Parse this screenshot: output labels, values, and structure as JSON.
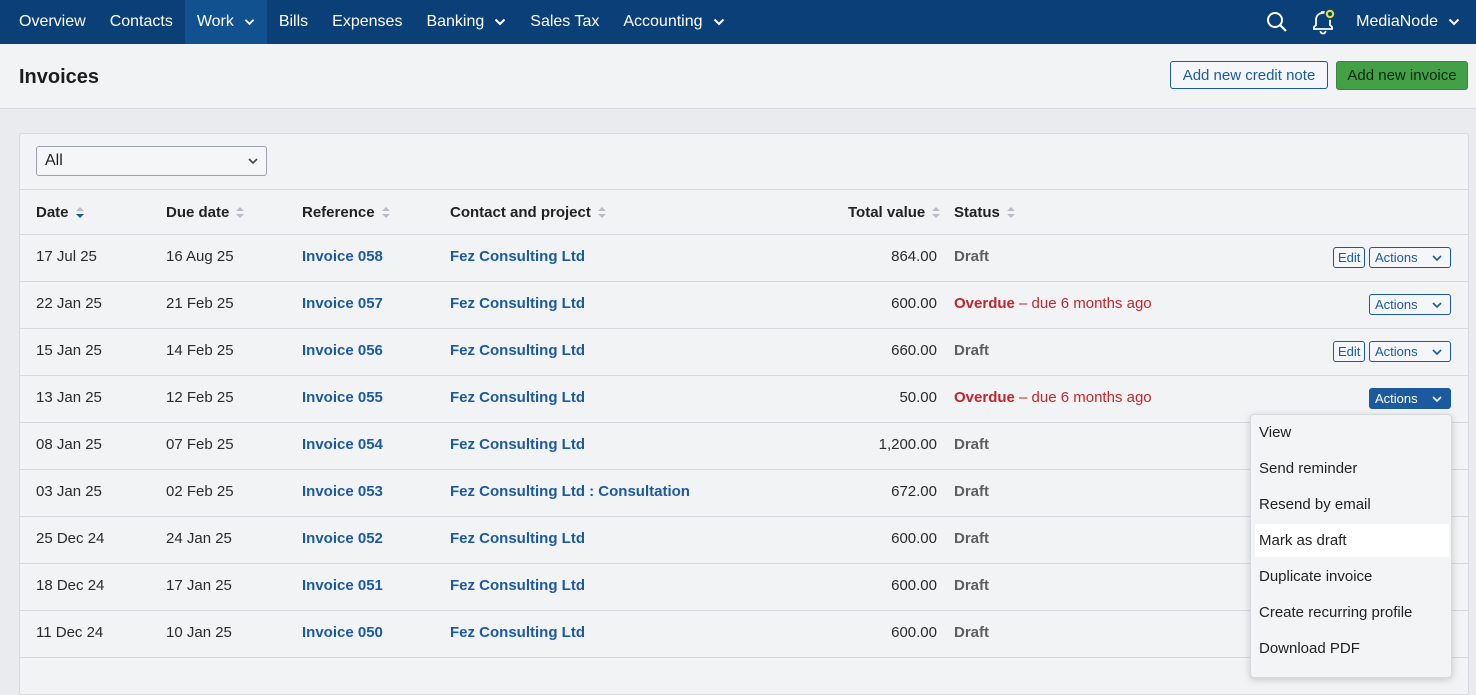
{
  "nav": {
    "items": [
      {
        "label": "Overview",
        "dropdown": false
      },
      {
        "label": "Contacts",
        "dropdown": false
      },
      {
        "label": "Work",
        "dropdown": true,
        "active": true
      },
      {
        "label": "Bills",
        "dropdown": false
      },
      {
        "label": "Expenses",
        "dropdown": false
      },
      {
        "label": "Banking",
        "dropdown": true
      },
      {
        "label": "Sales Tax",
        "dropdown": false
      },
      {
        "label": "Accounting",
        "dropdown": true
      }
    ],
    "user": "MediaNode",
    "icons": {
      "search": "search-icon",
      "notifications": "bell-icon"
    },
    "colors": {
      "bar": "#0b3f78",
      "active": "#12518f"
    }
  },
  "header": {
    "title": "Invoices",
    "credit_note_button": "Add new credit note",
    "new_invoice_button": "Add new invoice"
  },
  "filter": {
    "value": "All"
  },
  "table": {
    "columns": [
      "Date",
      "Due date",
      "Reference",
      "Contact and project",
      "Total value",
      "Status"
    ],
    "rows": [
      {
        "date": "17 Jul 25",
        "due": "16 Aug 25",
        "ref": "Invoice 058",
        "contact": "Fez Consulting Ltd",
        "total": "864.00",
        "status": "Draft",
        "status_note": "",
        "edit": "Edit",
        "actions": "Actions"
      },
      {
        "date": "22 Jan 25",
        "due": "21 Feb 25",
        "ref": "Invoice 057",
        "contact": "Fez Consulting Ltd",
        "total": "600.00",
        "status": "Overdue",
        "status_note": " – due 6 months ago",
        "edit": "",
        "actions": "Actions"
      },
      {
        "date": "15 Jan 25",
        "due": "14 Feb 25",
        "ref": "Invoice 056",
        "contact": "Fez Consulting Ltd",
        "total": "660.00",
        "status": "Draft",
        "status_note": "",
        "edit": "Edit",
        "actions": "Actions"
      },
      {
        "date": "13 Jan 25",
        "due": "12 Feb 25",
        "ref": "Invoice 055",
        "contact": "Fez Consulting Ltd",
        "total": "50.00",
        "status": "Overdue",
        "status_note": " – due 6 months ago",
        "edit": "",
        "actions": "Actions"
      },
      {
        "date": "08 Jan 25",
        "due": "07 Feb 25",
        "ref": "Invoice 054",
        "contact": "Fez Consulting Ltd",
        "total": "1,200.00",
        "status": "Draft",
        "status_note": "",
        "edit": "",
        "actions": ""
      },
      {
        "date": "03 Jan 25",
        "due": "02 Feb 25",
        "ref": "Invoice 053",
        "contact": "Fez Consulting Ltd : Consultation",
        "total": "672.00",
        "status": "Draft",
        "status_note": "",
        "edit": "",
        "actions": ""
      },
      {
        "date": "25 Dec 24",
        "due": "24 Jan 25",
        "ref": "Invoice 052",
        "contact": "Fez Consulting Ltd",
        "total": "600.00",
        "status": "Draft",
        "status_note": "",
        "edit": "",
        "actions": ""
      },
      {
        "date": "18 Dec 24",
        "due": "17 Jan 25",
        "ref": "Invoice 051",
        "contact": "Fez Consulting Ltd",
        "total": "600.00",
        "status": "Draft",
        "status_note": "",
        "edit": "",
        "actions": ""
      },
      {
        "date": "11 Dec 24",
        "due": "10 Jan 25",
        "ref": "Invoice 050",
        "contact": "Fez Consulting Ltd",
        "total": "600.00",
        "status": "Draft",
        "status_note": "",
        "edit": "",
        "actions": ""
      }
    ]
  },
  "actions_menu": {
    "items": [
      "View",
      "Send reminder",
      "Resend by email",
      "Mark as draft",
      "Duplicate invoice",
      "Create recurring profile",
      "Download PDF"
    ],
    "highlighted": "Mark as draft"
  }
}
